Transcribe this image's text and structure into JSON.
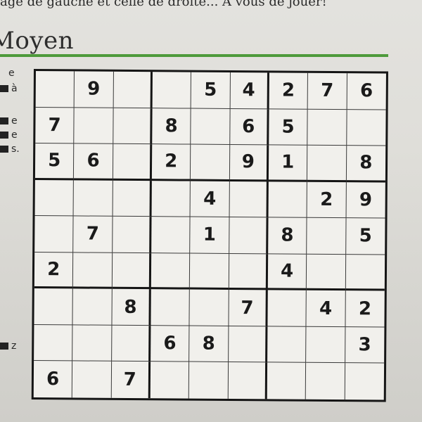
{
  "header": {
    "top_text": "age de gauche et celle de droite... À vous de jouer!",
    "title": "Moyen"
  },
  "side_fragments": [
    {
      "text": "e",
      "block": false
    },
    {
      "text": "à",
      "block": true
    },
    {
      "text": "e",
      "block": true
    },
    {
      "text": "e",
      "block": true
    },
    {
      "text": "s.",
      "block": true
    },
    {
      "text": "z",
      "block": true
    }
  ],
  "sudoku": {
    "rows": [
      [
        "",
        "9",
        "",
        "",
        "5",
        "4",
        "2",
        "7",
        "6"
      ],
      [
        "7",
        "",
        "",
        "8",
        "",
        "6",
        "5",
        "",
        ""
      ],
      [
        "5",
        "6",
        "",
        "2",
        "",
        "9",
        "1",
        "",
        "8"
      ],
      [
        "",
        "",
        "",
        "",
        "4",
        "",
        "",
        "2",
        "9"
      ],
      [
        "",
        "7",
        "",
        "",
        "1",
        "",
        "8",
        "",
        "5"
      ],
      [
        "2",
        "",
        "",
        "",
        "",
        "",
        "4",
        "",
        ""
      ],
      [
        "",
        "",
        "8",
        "",
        "",
        "7",
        "",
        "4",
        "2"
      ],
      [
        "",
        "",
        "",
        "6",
        "8",
        "",
        "",
        "",
        "3"
      ],
      [
        "6",
        "",
        "7",
        "",
        "",
        "",
        "",
        "",
        ""
      ]
    ]
  }
}
